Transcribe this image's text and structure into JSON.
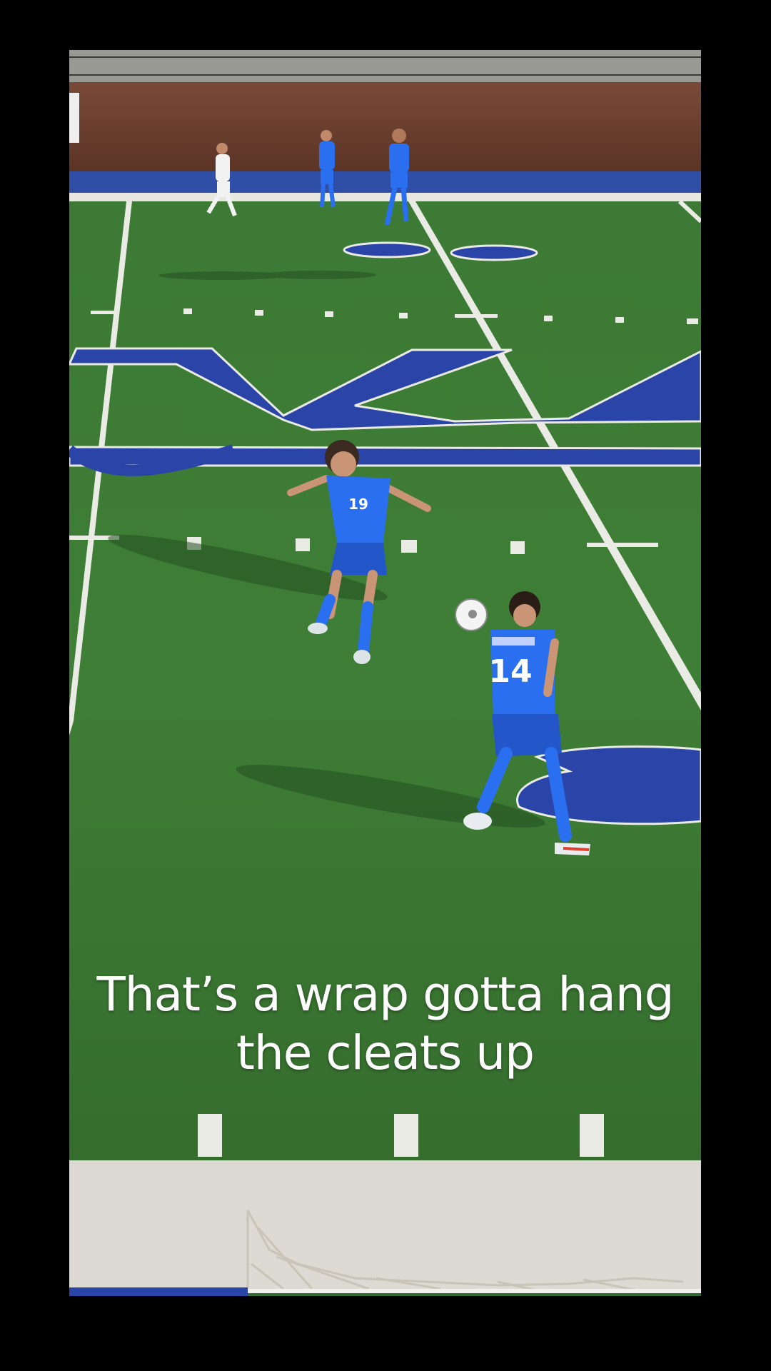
{
  "video": {
    "caption_lines": [
      "That’s a wrap gotta hang",
      "the cleats up"
    ],
    "jerseys": {
      "player_a_number": "19",
      "player_b_number": "14"
    }
  },
  "colors": {
    "background": "#000000",
    "turf": "#3f7a34",
    "team_blue": "#2a6ff0",
    "field_blue": "#2b44a8",
    "caption_text": "#ffffff"
  }
}
